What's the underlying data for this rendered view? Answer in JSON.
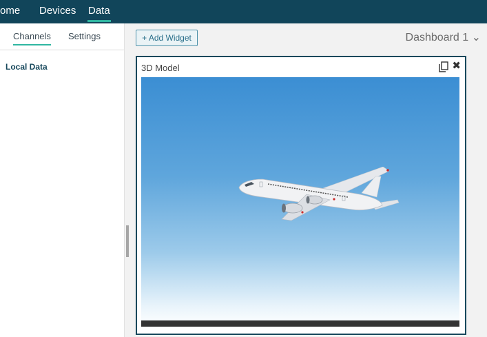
{
  "nav": {
    "home": "ome",
    "devices": "Devices",
    "data": "Data"
  },
  "left_panel": {
    "tabs": {
      "channels": "Channels",
      "settings": "Settings"
    },
    "section_title": "Local Data"
  },
  "toolbar": {
    "add_widget_label": "+ Add Widget",
    "dashboard_title": "Dashboard 1 ⌄"
  },
  "widget": {
    "title": "3D Model"
  },
  "colors": {
    "topbar": "#11455a",
    "accent": "#2fb6a1",
    "widget_border": "#17485c"
  }
}
